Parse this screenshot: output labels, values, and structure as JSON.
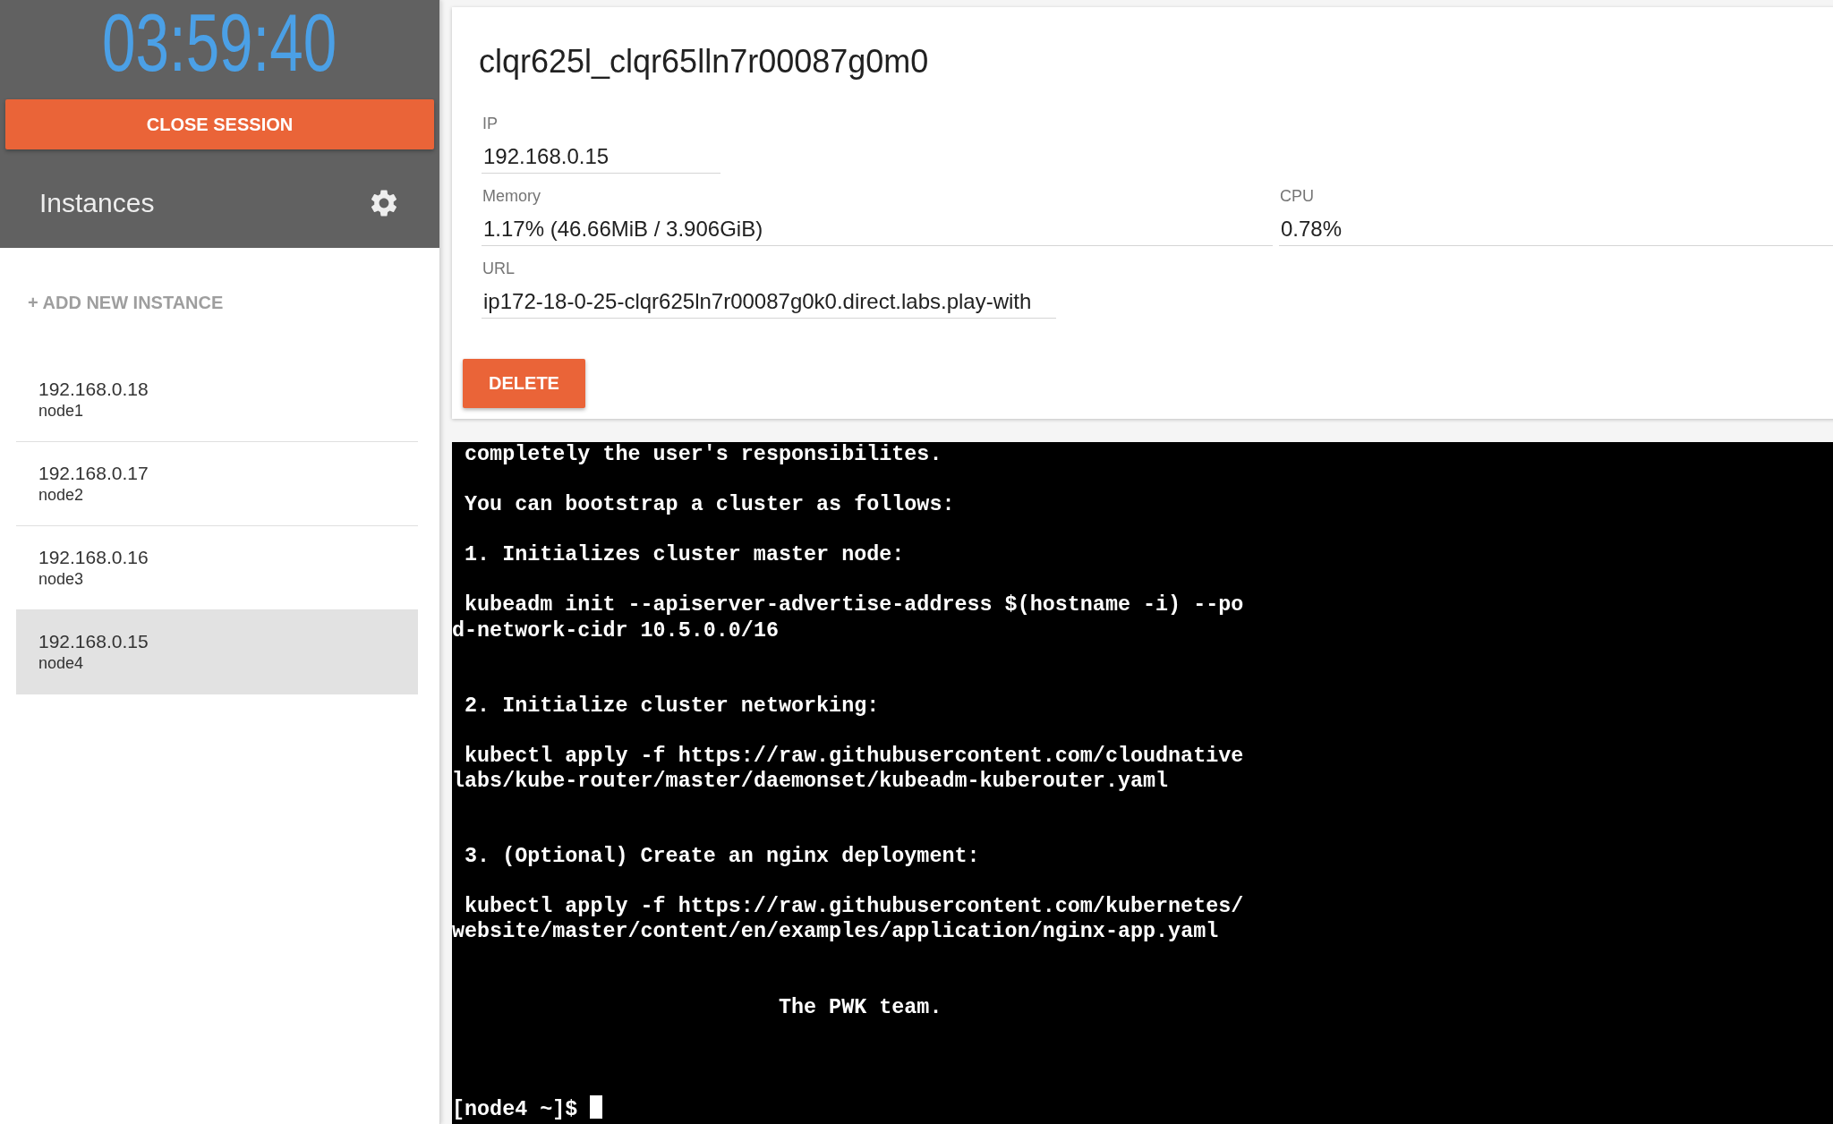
{
  "sidebar": {
    "timer": "03:59:40",
    "close_button": "CLOSE SESSION",
    "title": "Instances",
    "add_button": "+ ADD NEW INSTANCE",
    "instances": [
      {
        "ip": "192.168.0.18",
        "name": "node1",
        "selected": false
      },
      {
        "ip": "192.168.0.17",
        "name": "node2",
        "selected": false
      },
      {
        "ip": "192.168.0.16",
        "name": "node3",
        "selected": false
      },
      {
        "ip": "192.168.0.15",
        "name": "node4",
        "selected": true
      }
    ]
  },
  "instance_panel": {
    "title": "clqr625l_clqr65lln7r00087g0m0",
    "field_rows": [
      {
        "fields": [
          {
            "label": "IP",
            "value": "192.168.0.15"
          }
        ]
      },
      {
        "fields": [
          {
            "label": "Memory",
            "value": "1.17% (46.66MiB / 3.906GiB)"
          },
          {
            "label": "CPU",
            "value": "0.78%"
          }
        ]
      },
      {
        "fields": [
          {
            "label": "URL",
            "value": "ip172-18-0-25-clqr625ln7r00087g0k0.direct.labs.play-with"
          }
        ]
      }
    ],
    "delete_button": "DELETE"
  },
  "terminal": {
    "lines": [
      {
        "kind": "text",
        "text": "completely the user's responsibilites."
      },
      {
        "kind": "blank"
      },
      {
        "kind": "text",
        "text": "You can bootstrap a cluster as follows:"
      },
      {
        "kind": "blank"
      },
      {
        "kind": "text",
        "text": "1. Initializes cluster master node:"
      },
      {
        "kind": "blank"
      },
      {
        "kind": "text",
        "text": "kubeadm init --apiserver-advertise-address $(hostname -i) --po"
      },
      {
        "kind": "continuation",
        "text": "d-network-cidr 10.5.0.0/16"
      },
      {
        "kind": "blank"
      },
      {
        "kind": "blank"
      },
      {
        "kind": "text",
        "text": "2. Initialize cluster networking:"
      },
      {
        "kind": "blank"
      },
      {
        "kind": "text",
        "text": "kubectl apply -f https://raw.githubusercontent.com/cloudnative"
      },
      {
        "kind": "continuation",
        "text": "labs/kube-router/master/daemonset/kubeadm-kuberouter.yaml"
      },
      {
        "kind": "blank"
      },
      {
        "kind": "blank"
      },
      {
        "kind": "text",
        "text": "3. (Optional) Create an nginx deployment:"
      },
      {
        "kind": "blank"
      },
      {
        "kind": "text",
        "text": "kubectl apply -f https://raw.githubusercontent.com/kubernetes/"
      },
      {
        "kind": "continuation",
        "text": "website/master/content/en/examples/application/nginx-app.yaml"
      },
      {
        "kind": "blank"
      },
      {
        "kind": "blank"
      },
      {
        "kind": "signature",
        "text": "The PWK team."
      },
      {
        "kind": "blank"
      },
      {
        "kind": "blank"
      },
      {
        "kind": "blank"
      }
    ],
    "prompt": "[node4 ~]$"
  }
}
